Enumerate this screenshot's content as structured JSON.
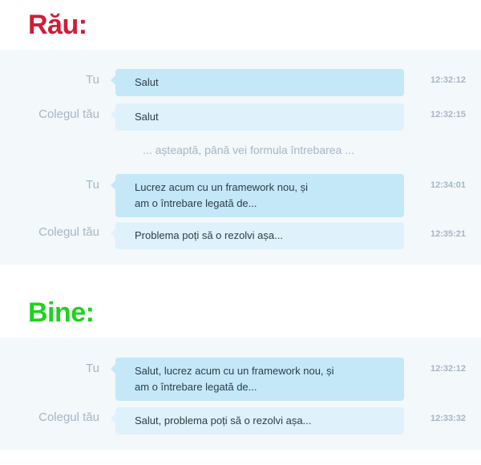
{
  "bad": {
    "title": "Rău:",
    "messages": [
      {
        "sender": "Tu",
        "text": "Salut",
        "time": "12:32:12"
      },
      {
        "sender": "Colegul tău",
        "text": "Salut",
        "time": "12:32:15"
      },
      {
        "sender": "Tu",
        "text": "Lucrez acum cu un framework nou, și\nam o întrebare legată de...",
        "time": "12:34:01"
      },
      {
        "sender": "Colegul tău",
        "text": "Problema poți să o rezolvi așa...",
        "time": "12:35:21"
      }
    ],
    "waiting": "... așteaptă, până vei formula întrebarea ..."
  },
  "good": {
    "title": "Bine:",
    "messages": [
      {
        "sender": "Tu",
        "text": "Salut, lucrez acum cu un framework nou, și\nam o întrebare legată de...",
        "time": "12:32:12"
      },
      {
        "sender": "Colegul tău",
        "text": "Salut, problema poți să o rezolvi așa...",
        "time": "12:33:32"
      }
    ]
  },
  "colors": {
    "bad_heading": "#d21b36",
    "good_heading": "#1fd21f",
    "my_bubble": "#c4e8f8",
    "colleague_bubble": "#dff1fa",
    "panel_background": "#f3f8fb"
  }
}
